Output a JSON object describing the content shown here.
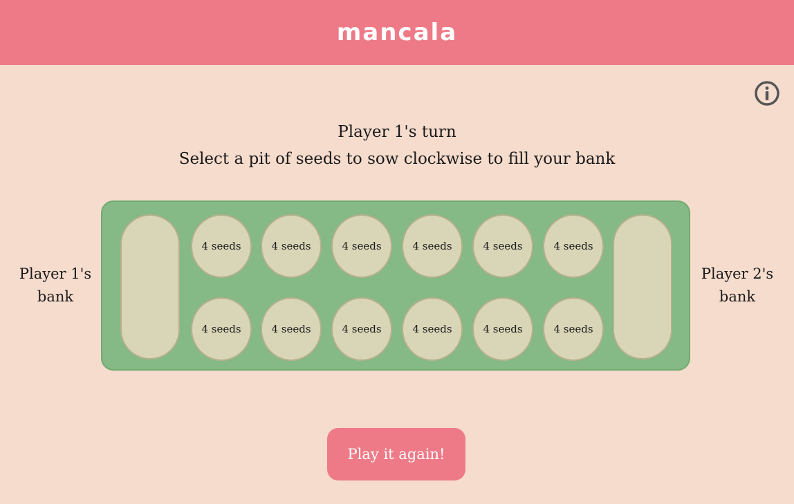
{
  "header": {
    "title": "mancala"
  },
  "info": {
    "icon": "info-circle-icon"
  },
  "status": {
    "turn": "Player 1's turn",
    "instruction": "Select a pit of seeds to sow clockwise to fill your bank"
  },
  "banks": {
    "left_label_line1": "Player 1's",
    "left_label_line2": "bank",
    "right_label_line1": "Player 2's",
    "right_label_line2": "bank",
    "left_value": "",
    "right_value": ""
  },
  "board": {
    "top_row": [
      "4 seeds",
      "4 seeds",
      "4 seeds",
      "4 seeds",
      "4 seeds",
      "4 seeds"
    ],
    "bottom_row": [
      "4 seeds",
      "4 seeds",
      "4 seeds",
      "4 seeds",
      "4 seeds",
      "4 seeds"
    ]
  },
  "actions": {
    "play_again": "Play it again!"
  },
  "colors": {
    "header": "#ee7a87",
    "background": "#f5dccd",
    "board": "#85b985",
    "pit": "#d9d6b8",
    "button": "#ee7a87"
  }
}
